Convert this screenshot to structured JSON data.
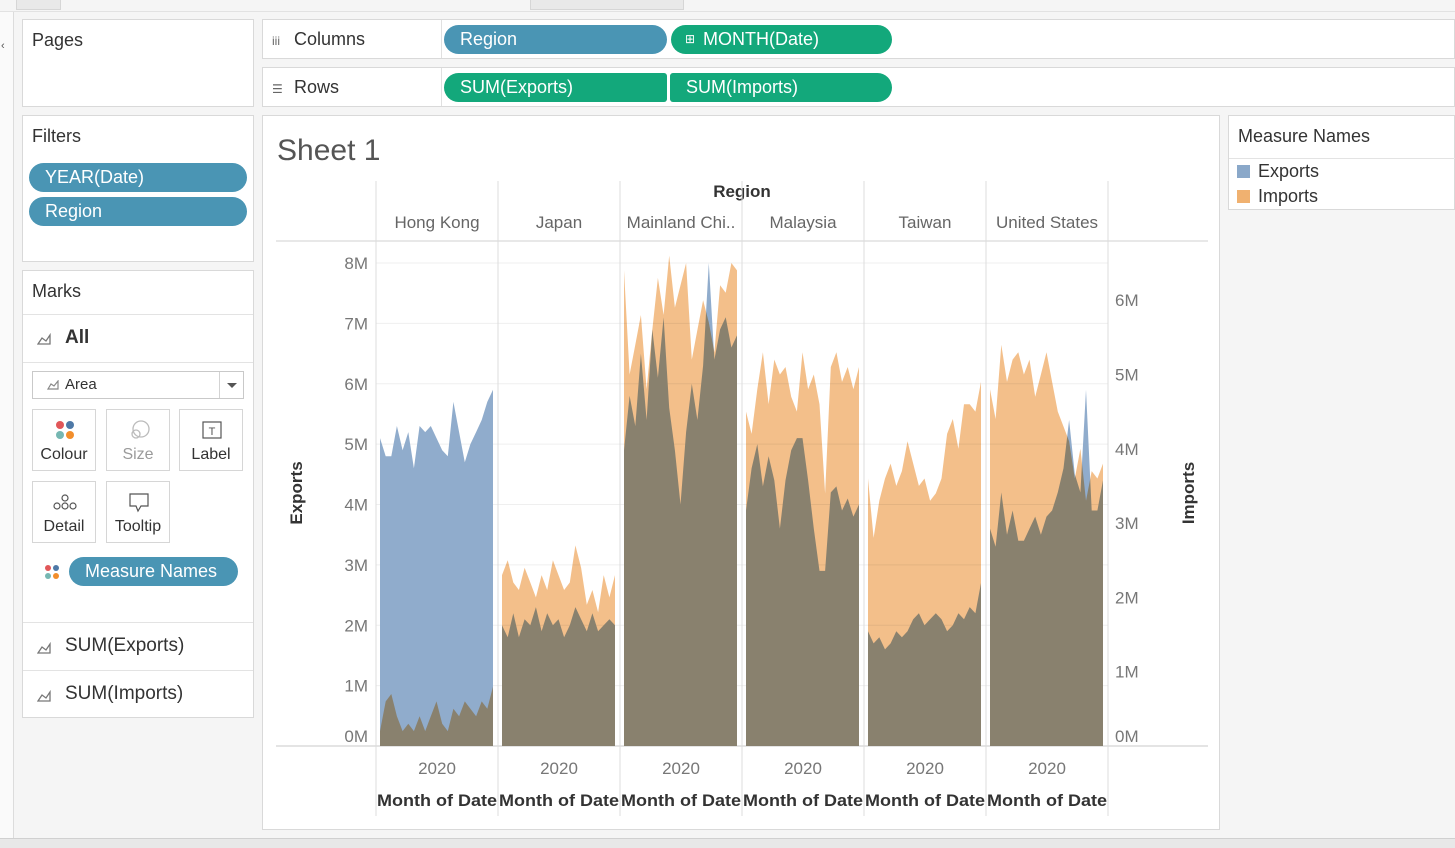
{
  "colors": {
    "exports": "#8aa8c9",
    "imports": "#f0b170",
    "overlap": "#c99761",
    "pill_blue": "#4a95b4",
    "pill_green": "#13a87b"
  },
  "pages": {
    "title": "Pages"
  },
  "filters": {
    "title": "Filters",
    "pills": [
      "YEAR(Date)",
      "Region"
    ]
  },
  "marks": {
    "title": "Marks",
    "all_label": "All",
    "mark_type": "Area",
    "buttons": {
      "colour": "Colour",
      "size": "Size",
      "label": "Label",
      "detail": "Detail",
      "tooltip": "Tooltip"
    },
    "colour_pill": "Measure Names",
    "measures": [
      "SUM(Exports)",
      "SUM(Imports)"
    ]
  },
  "columns_shelf": {
    "label": "Columns",
    "pills": [
      "Region",
      "MONTH(Date)"
    ]
  },
  "rows_shelf": {
    "label": "Rows",
    "pills": [
      "SUM(Exports)",
      "SUM(Imports)"
    ]
  },
  "sheet": {
    "title": "Sheet 1"
  },
  "legend": {
    "title": "Measure Names",
    "items": [
      "Exports",
      "Imports"
    ]
  },
  "chart_data": {
    "type": "area",
    "header": "Region",
    "regions": [
      "Hong Kong",
      "Japan",
      "Mainland Chi..",
      "Malaysia",
      "Taiwan",
      "United States"
    ],
    "x_tick": "2020",
    "x_axis_label": "Month of Date",
    "left_axis": {
      "label": "Exports",
      "ticks": [
        "0M",
        "1M",
        "2M",
        "3M",
        "4M",
        "5M",
        "6M",
        "7M",
        "8M"
      ],
      "range": [
        0,
        8000000
      ]
    },
    "right_axis": {
      "label": "Imports",
      "ticks": [
        "0M",
        "1M",
        "2M",
        "3M",
        "4M",
        "5M",
        "6M"
      ],
      "range": [
        0,
        6500000
      ]
    },
    "series": [
      {
        "name": "Exports",
        "values_by_region": {
          "Hong Kong": [
            5.1,
            4.8,
            4.8,
            5.3,
            4.9,
            5.2,
            4.6,
            5.3,
            5.2,
            5.3,
            5.1,
            4.9,
            4.8,
            5.7,
            5.2,
            4.7,
            5.0,
            5.2,
            5.4,
            5.7,
            5.9
          ],
          "Japan": [
            2.0,
            1.8,
            2.2,
            1.8,
            2.1,
            2.0,
            2.3,
            1.9,
            2.2,
            2.0,
            2.1,
            1.8,
            2.0,
            2.3,
            2.1,
            1.9,
            2.2,
            1.9,
            2.0,
            2.1,
            2.0
          ],
          "Mainland Chi..": [
            4.9,
            5.8,
            5.3,
            6.5,
            5.4,
            6.9,
            6.1,
            7.1,
            5.6,
            4.9,
            4.0,
            5.2,
            6.0,
            5.4,
            6.3,
            8.0,
            6.4,
            6.9,
            7.1,
            6.6,
            6.8
          ],
          "Malaysia": [
            3.9,
            4.6,
            5.0,
            4.3,
            4.8,
            4.4,
            3.6,
            4.4,
            4.9,
            5.1,
            5.1,
            4.4,
            3.6,
            2.9,
            2.9,
            4.2,
            4.3,
            3.9,
            4.1,
            3.8,
            4.0
          ],
          "Taiwan": [
            1.9,
            1.7,
            1.8,
            1.6,
            1.7,
            1.9,
            1.8,
            1.9,
            2.1,
            2.2,
            2.0,
            2.1,
            2.2,
            2.1,
            1.9,
            2.0,
            2.2,
            2.1,
            2.3,
            2.2,
            2.7
          ],
          "United States": [
            3.6,
            3.3,
            4.2,
            3.5,
            3.9,
            3.4,
            3.4,
            3.6,
            3.8,
            3.5,
            3.8,
            3.9,
            4.2,
            4.6,
            5.4,
            4.5,
            4.2,
            5.9,
            3.9,
            3.9,
            4.4
          ]
        }
      },
      {
        "name": "Imports",
        "values_by_region": {
          "Hong Kong": [
            0.2,
            0.6,
            0.7,
            0.4,
            0.2,
            0.3,
            0.2,
            0.4,
            0.2,
            0.4,
            0.6,
            0.3,
            0.2,
            0.5,
            0.4,
            0.6,
            0.5,
            0.4,
            0.6,
            0.5,
            0.8
          ],
          "Japan": [
            2.3,
            2.5,
            2.2,
            2.1,
            2.4,
            2.2,
            2.0,
            2.3,
            2.1,
            2.5,
            2.3,
            2.1,
            2.2,
            2.7,
            2.4,
            1.9,
            2.1,
            1.8,
            2.3,
            2.0,
            2.3
          ],
          "Mainland Chi..": [
            6.4,
            5.0,
            5.4,
            5.8,
            4.8,
            5.6,
            6.3,
            5.8,
            6.6,
            5.9,
            6.2,
            6.5,
            5.2,
            5.6,
            6.0,
            5.7,
            5.3,
            6.2,
            6.1,
            6.5,
            6.4
          ],
          "Malaysia": [
            4.5,
            4.2,
            4.8,
            5.3,
            4.6,
            5.2,
            5.0,
            5.1,
            4.7,
            4.5,
            5.3,
            4.8,
            5.0,
            4.6,
            3.4,
            5.1,
            5.3,
            4.9,
            5.1,
            4.8,
            5.1
          ],
          "Taiwan": [
            3.6,
            2.8,
            3.3,
            3.6,
            3.8,
            3.5,
            3.7,
            4.1,
            3.8,
            3.5,
            3.6,
            3.3,
            3.4,
            3.6,
            4.2,
            4.4,
            4.0,
            4.6,
            4.6,
            4.5,
            4.9
          ],
          "United States": [
            4.8,
            4.4,
            5.4,
            4.9,
            5.2,
            5.3,
            5.0,
            5.2,
            4.7,
            5.0,
            5.3,
            4.9,
            4.5,
            4.3,
            4.1,
            3.6,
            4.0,
            3.3,
            3.7,
            3.6,
            3.8
          ]
        }
      }
    ]
  }
}
